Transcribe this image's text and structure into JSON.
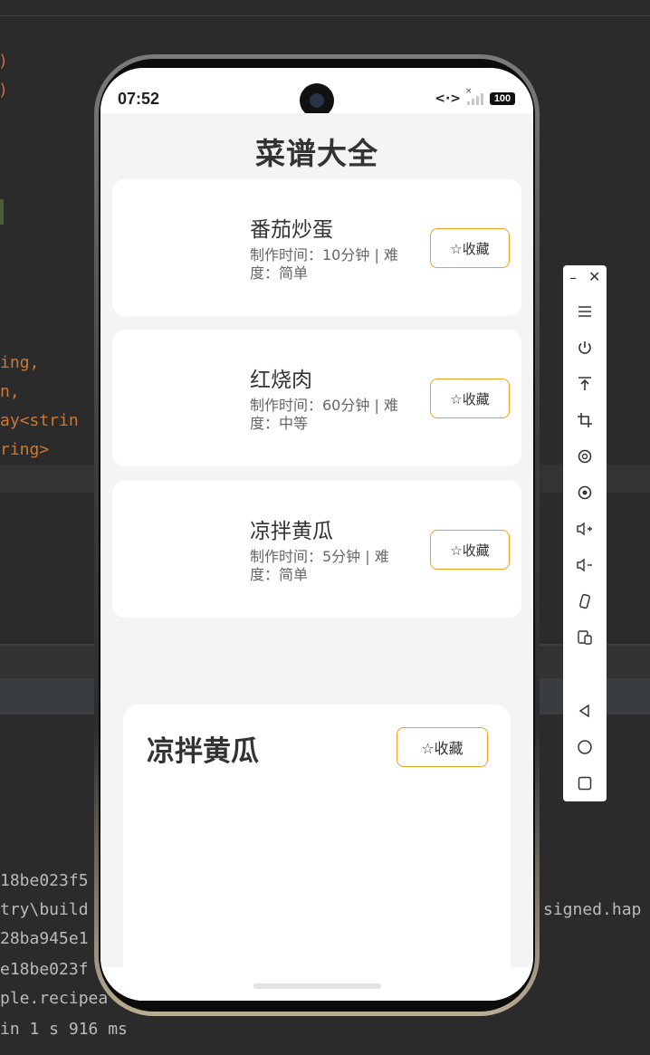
{
  "ide": {
    "code_lines": [
      {
        "text": ")",
        "color": "red"
      },
      {
        "text": ")",
        "color": "red"
      },
      {
        "text": "ing,",
        "color": "orange"
      },
      {
        "text": "n,",
        "color": "orange"
      },
      {
        "text": "ay<strin",
        "color": "orange"
      },
      {
        "text": "ring>",
        "color": "orange"
      }
    ],
    "log_lines": [
      "18be023f5",
      "try\\build",
      "28ba945e1",
      "e18be023f",
      "ple.recipea",
      "in 1 s 916 ms"
    ],
    "log_right": "signed.hap"
  },
  "phone": {
    "status": {
      "time": "07:52",
      "battery": "100"
    },
    "app": {
      "title": "菜谱大全",
      "recipes": [
        {
          "name": "番茄炒蛋",
          "meta": "制作时间：10分钟 | 难度：简单",
          "fav_label": "☆收藏"
        },
        {
          "name": "红烧肉",
          "meta": "制作时间：60分钟 | 难度：中等",
          "fav_label": "☆收藏"
        },
        {
          "name": "凉拌黄瓜",
          "meta": "制作时间：5分钟 | 难度：简单",
          "fav_label": "☆收藏"
        }
      ],
      "detail": {
        "title": "凉拌黄瓜",
        "fav_label": "☆收藏"
      }
    }
  },
  "emulator_toolbar": {
    "buttons": [
      "menu-icon",
      "power-icon",
      "top-icon",
      "crop-icon",
      "rotate-icon",
      "screenshot-icon",
      "volume-up-icon",
      "volume-down-icon",
      "shake-icon",
      "multi-device-icon",
      "back-icon",
      "home-icon",
      "recents-icon"
    ]
  },
  "colors": {
    "accent_border": "#f0a020",
    "app_background": "#f4f4f4",
    "ide_background": "#2b2b2b"
  }
}
